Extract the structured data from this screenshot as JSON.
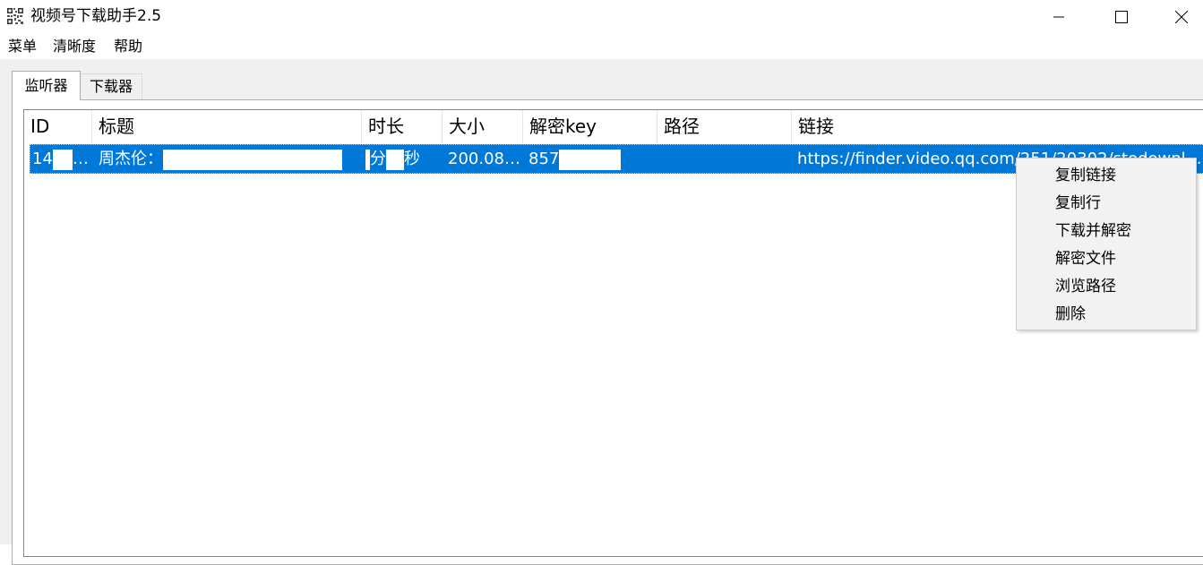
{
  "window": {
    "title": "视频号下载助手2.5",
    "icon": "qr-code-icon",
    "controls": [
      "minimize-icon",
      "maximize-icon",
      "close-icon"
    ]
  },
  "menubar": {
    "items": [
      "菜单",
      "清晰度",
      "帮助"
    ]
  },
  "tabs": {
    "active": "监听器",
    "inactive": "下载器"
  },
  "table": {
    "columns": [
      "ID",
      "标题",
      "时长",
      "大小",
      "解密key",
      "路径",
      "链接"
    ],
    "selected_row": {
      "id_prefix": "14",
      "id_suffix": "…",
      "title_prefix": "周杰伦：",
      "duration_min_label": "分",
      "duration_sec_label": "秒",
      "size": "200.08…",
      "key_prefix": "857",
      "path": "",
      "link": "https://finder.video.qq.com/251/20302/stodownload…"
    }
  },
  "context_menu": {
    "items": [
      "复制链接",
      "复制行",
      "下载并解密",
      "解密文件",
      "浏览路径",
      "删除"
    ]
  },
  "colors": {
    "selection": "#0078d7",
    "client_background": "#f0f0f0",
    "menu_background": "#f2f2f2"
  }
}
